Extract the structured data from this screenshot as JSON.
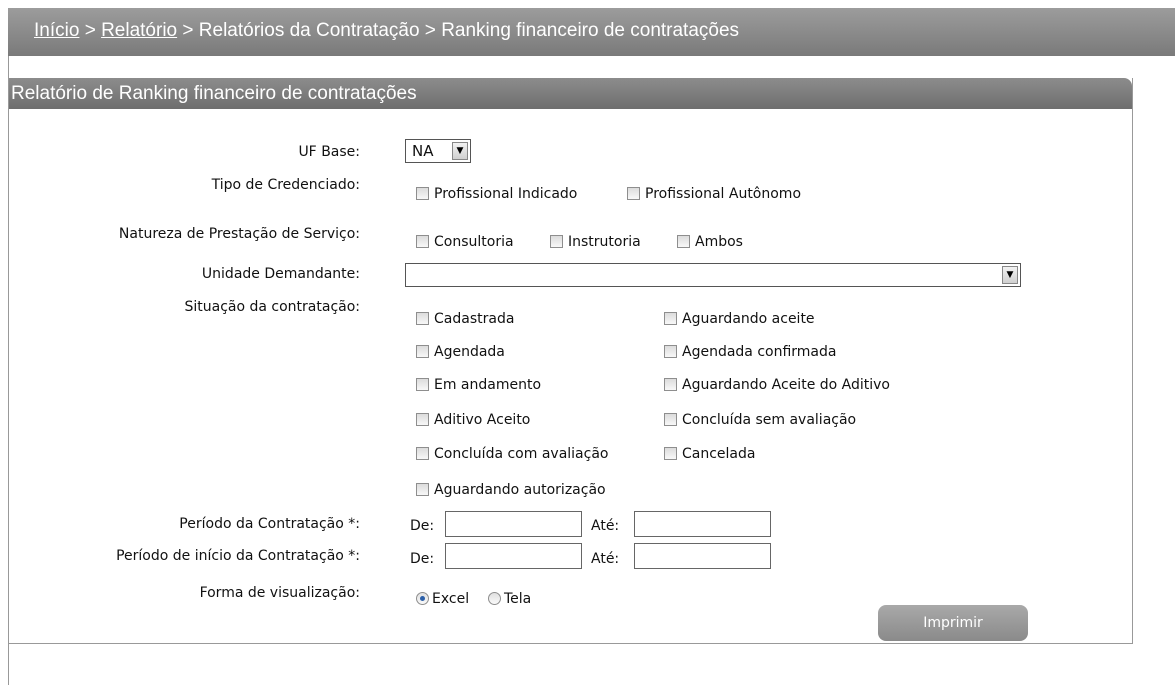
{
  "breadcrumb": {
    "home": "Início",
    "sep1": " > ",
    "report": "Relatório",
    "sep2": " > ",
    "contracting": "Relatórios da Contratação",
    "sep3": " >  ",
    "current": "Ranking financeiro de contratações"
  },
  "panel": {
    "title": "Relatório de Ranking financeiro de contratações"
  },
  "form": {
    "uf_label": "UF Base:",
    "uf_value": "NA",
    "tipo_label": "Tipo de Credenciado:",
    "tipo_options": [
      "Profissional Indicado",
      "Profissional Autônomo"
    ],
    "natureza_label": "Natureza de Prestação de Serviço:",
    "natureza_options": [
      "Consultoria",
      "Instrutoria",
      "Ambos"
    ],
    "unidade_label": "Unidade Demandante:",
    "unidade_value": "",
    "situacao_label": "Situação da contratação:",
    "situacao_options": [
      "Cadastrada",
      "Aguardando aceite",
      "Agendada",
      "Agendada confirmada",
      "Em andamento",
      "Aguardando Aceite do Aditivo",
      "Aditivo Aceito",
      "Concluída sem avaliação",
      "Concluída com avaliação",
      "Cancelada",
      "Aguardando autorização"
    ],
    "periodo_label": "Período da Contratação *:",
    "periodo_inicio_label": "Período de início da Contratação *:",
    "de_label": "De:",
    "ate_label": "Até:",
    "visualizacao_label": "Forma de visualização:",
    "visualizacao_options": [
      "Excel",
      "Tela"
    ],
    "visualizacao_selected": "Excel",
    "print_button": "Imprimir"
  }
}
